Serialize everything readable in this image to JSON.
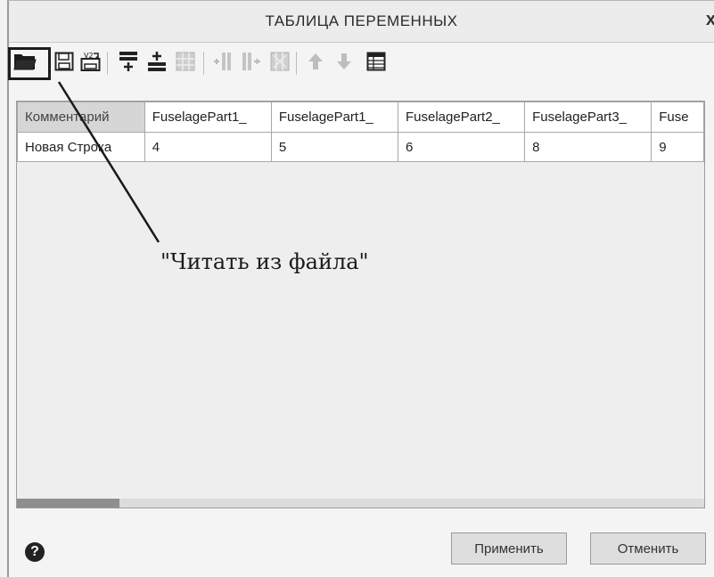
{
  "window": {
    "title": "ТАБЛИЦА ПЕРЕМЕННЫХ",
    "close_label": "x"
  },
  "toolbar": {
    "buttons": [
      "open-folder-icon",
      "save-icon",
      "save-as-icon",
      "insert-row-icon",
      "add-row-icon",
      "delete-row-icon",
      "insert-column-icon",
      "add-column-icon",
      "delete-column-icon",
      "move-up-icon",
      "move-down-icon",
      "table-icon"
    ]
  },
  "table": {
    "headers": [
      "Комментарий",
      "FuselagePart1_",
      "FuselagePart1_",
      "FuselagePart2_",
      "FuselagePart3_",
      "Fuse"
    ],
    "rows": [
      [
        "Новая Строка",
        "4",
        "5",
        "6",
        "8",
        "9"
      ]
    ]
  },
  "annotation": {
    "text": "\"Читать из файла\""
  },
  "footer": {
    "help_label": "?",
    "apply_label": "Применить",
    "cancel_label": "Отменить"
  }
}
